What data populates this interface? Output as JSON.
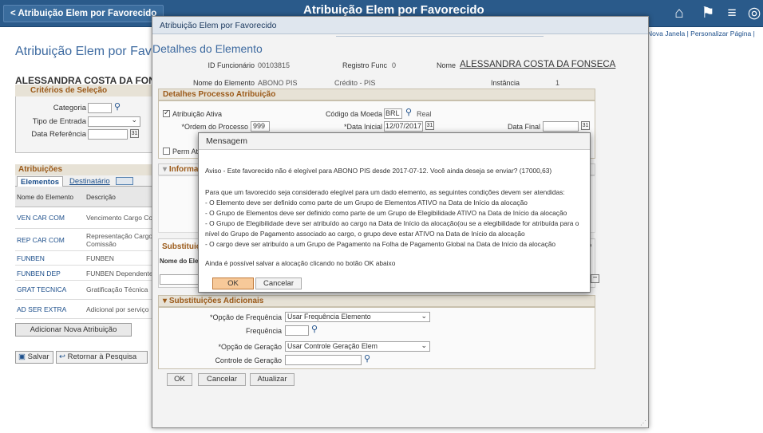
{
  "topbar": {
    "back_label": "< Atribuição Elem por Favorecido",
    "title": "Atribuição Elem por Favorecido",
    "icons": [
      "home-icon",
      "flag-icon",
      "menu-icon",
      "navbar-icon"
    ],
    "links": "Nova Janela | Personalizar Página |"
  },
  "background": {
    "page_title": "Atribuição Elem por Favorecido",
    "employee_name": "ALESSANDRA COSTA DA FONSECA",
    "criteria_header": "Critérios de Seleção",
    "category_label": "Categoria",
    "entry_type_label": "Tipo de Entrada",
    "ref_date_label": "Data Referência",
    "attributions_header": "Atribuições",
    "tabs": [
      "Elementos",
      "Destinatário"
    ],
    "grid_headers": [
      "Nome do Elemento",
      "Descrição"
    ],
    "rows": [
      {
        "name": "VEN CAR COM",
        "desc": "Vencimento Cargo Co"
      },
      {
        "name": "REP CAR COM",
        "desc": "Representação Cargo Comissão"
      },
      {
        "name": "FUNBEN",
        "desc": "FUNBEN"
      },
      {
        "name": "FUNBEN DEP",
        "desc": "FUNBEN Dependente"
      },
      {
        "name": "GRAT TECNICA",
        "desc": "Gratificação Técnica"
      },
      {
        "name": "AD SER EXTRA",
        "desc": "Adicional por serviço"
      }
    ],
    "add_button": "Adicionar Nova Atribuição",
    "save_button": "Salvar",
    "return_button": "Retornar à Pesquisa"
  },
  "outer_modal": {
    "title": "Atribuição Elem por Favorecido",
    "heading": "Detalhes do Elemento",
    "emp_id_label": "ID Funcionário",
    "emp_id_value": "00103815",
    "reg_label": "Registro Func",
    "reg_value": "0",
    "name_label": "Nome",
    "name_value": "ALESSANDRA COSTA DA FONSECA",
    "element_label": "Nome do Elemento",
    "element_value": "ABONO PIS",
    "element_desc": "Crédito - PIS",
    "instance_label": "Instância",
    "instance_value": "1",
    "process_header": "Detalhes Processo Atribuição",
    "active_label": "Atribuição Ativa",
    "currency_label": "Código da Moeda",
    "currency_value": "BRL",
    "currency_name": "Real",
    "order_label": "*Ordem do Processo",
    "order_value": "999",
    "start_label": "*Data Inicial",
    "start_value": "12/07/2017",
    "end_label": "Data Final",
    "perm_label": "Perm At",
    "info_header": "Informa",
    "subst_header": "Substituiç",
    "subst_col": "Nome do Elem",
    "subst_col_right": "mo",
    "additional_header": "Substituições Adicionais",
    "freq_option_label": "*Opção de Frequência",
    "freq_option_value": "Usar Frequência Elemento",
    "freq_label": "Frequência",
    "gen_option_label": "*Opção de Geração",
    "gen_option_value": "Usar Controle Geração Elem",
    "gen_control_label": "Controle de Geração",
    "buttons": [
      "OK",
      "Cancelar",
      "Atualizar"
    ]
  },
  "message": {
    "title": "Mensagem",
    "warning": "Aviso - Este favorecido não é elegível para ABONO PIS desde 2017-07-12. Você ainda deseja se enviar? (17000,63)",
    "intro": "Para que um favorecido seja considerado elegível para um dado elemento, as seguintes condições devem ser atendidas:",
    "conditions": [
      "- O Elemento deve ser definido como parte de um Grupo de Elementos ATIVO na Data de Início da alocação",
      "- O Grupo de Elementos deve ser definido como parte de um Grupo de Elegibilidade ATIVO na Data de Início da alocação",
      "- O Grupo de Elegibilidade deve ser atribuído ao cargo na Data de Início da alocação(ou se a elegibilidade for atribuída para o",
      "nível do Grupo de Pagamento associado ao cargo, o grupo deve estar ATIVO na Data de Início da alocação",
      "- O cargo deve ser atribuído a um Grupo de Pagamento na Folha de Pagamento Global na Data de Início da alocação"
    ],
    "footer": "Ainda é possível salvar a alocação clicando no botão OK abaixo",
    "ok": "OK",
    "cancel": "Cancelar"
  }
}
